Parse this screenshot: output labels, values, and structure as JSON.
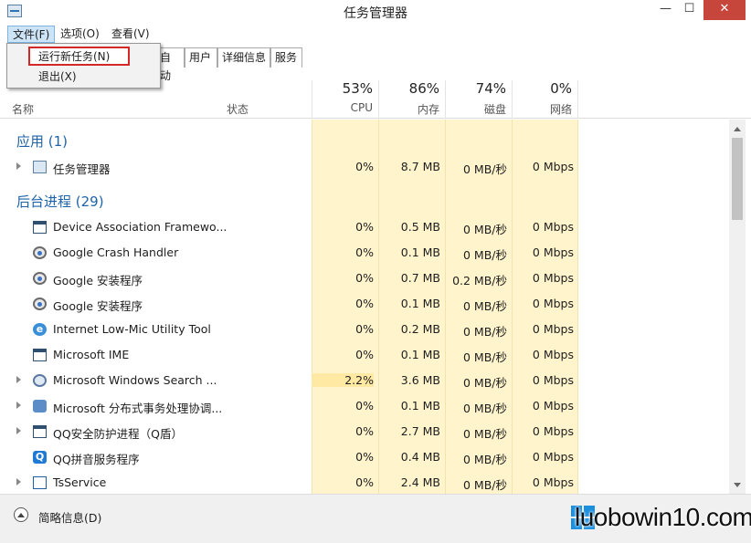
{
  "window": {
    "title": "任务管理器",
    "min": "—",
    "max": "☐",
    "close": "✕"
  },
  "menubar": [
    {
      "label": "文件(F)"
    },
    {
      "label": "选项(O)"
    },
    {
      "label": "查看(V)"
    }
  ],
  "dropdown": [
    {
      "label": "运行新任务(N)"
    },
    {
      "label": "退出(X)"
    }
  ],
  "tabs": [
    {
      "label": "自动"
    },
    {
      "label": "用户"
    },
    {
      "label": "详细信息"
    },
    {
      "label": "服务"
    }
  ],
  "columns": {
    "name": "名称",
    "status": "状态",
    "cpu": {
      "pct": "53%",
      "label": "CPU"
    },
    "memory": {
      "pct": "86%",
      "label": "内存"
    },
    "disk": {
      "pct": "74%",
      "label": "磁盘"
    },
    "network": {
      "pct": "0%",
      "label": "网络"
    }
  },
  "groups": {
    "apps": "应用 (1)",
    "background": "后台进程 (29)"
  },
  "app_rows": [
    {
      "name": "任务管理器",
      "icon": "task-manager-icon",
      "expandable": true,
      "cpu": "0%",
      "mem": "8.7 MB",
      "disk": "0 MB/秒",
      "net": "0 Mbps"
    }
  ],
  "bg_rows": [
    {
      "name": "Device Association Framewo...",
      "icon": "window-icon",
      "expandable": false,
      "cpu": "0%",
      "mem": "0.5 MB",
      "disk": "0 MB/秒",
      "net": "0 Mbps"
    },
    {
      "name": "Google Crash Handler",
      "icon": "gear-icon",
      "expandable": false,
      "cpu": "0%",
      "mem": "0.1 MB",
      "disk": "0 MB/秒",
      "net": "0 Mbps"
    },
    {
      "name": "Google 安装程序",
      "icon": "gear-icon",
      "expandable": false,
      "cpu": "0%",
      "mem": "0.7 MB",
      "disk": "0.2 MB/秒",
      "net": "0 Mbps"
    },
    {
      "name": "Google 安装程序",
      "icon": "gear-icon",
      "expandable": false,
      "cpu": "0%",
      "mem": "0.1 MB",
      "disk": "0 MB/秒",
      "net": "0 Mbps"
    },
    {
      "name": "Internet Low-Mic Utility Tool",
      "icon": "ie-icon",
      "expandable": false,
      "cpu": "0%",
      "mem": "0.2 MB",
      "disk": "0 MB/秒",
      "net": "0 Mbps"
    },
    {
      "name": "Microsoft IME",
      "icon": "window-icon",
      "expandable": false,
      "cpu": "0%",
      "mem": "0.1 MB",
      "disk": "0 MB/秒",
      "net": "0 Mbps"
    },
    {
      "name": "Microsoft Windows Search ...",
      "icon": "search-icon",
      "expandable": true,
      "cpu": "2.2%",
      "mem": "3.6 MB",
      "disk": "0 MB/秒",
      "net": "0 Mbps"
    },
    {
      "name": "Microsoft 分布式事务处理协调...",
      "icon": "dtc-icon",
      "expandable": true,
      "cpu": "0%",
      "mem": "0.1 MB",
      "disk": "0 MB/秒",
      "net": "0 Mbps"
    },
    {
      "name": "QQ安全防护进程（Q盾）",
      "icon": "window-icon",
      "expandable": true,
      "cpu": "0%",
      "mem": "2.7 MB",
      "disk": "0 MB/秒",
      "net": "0 Mbps"
    },
    {
      "name": "QQ拼音服务程序",
      "icon": "qq-pinyin-icon",
      "expandable": false,
      "cpu": "0%",
      "mem": "0.4 MB",
      "disk": "0 MB/秒",
      "net": "0 Mbps"
    },
    {
      "name": "TsService",
      "icon": "tsservice-icon",
      "expandable": true,
      "cpu": "0%",
      "mem": "2.4 MB",
      "disk": "0 MB/秒",
      "net": "0 Mbps"
    }
  ],
  "footer": {
    "fewer_details": "简略信息(D)"
  },
  "watermark": "luobowin10.com"
}
